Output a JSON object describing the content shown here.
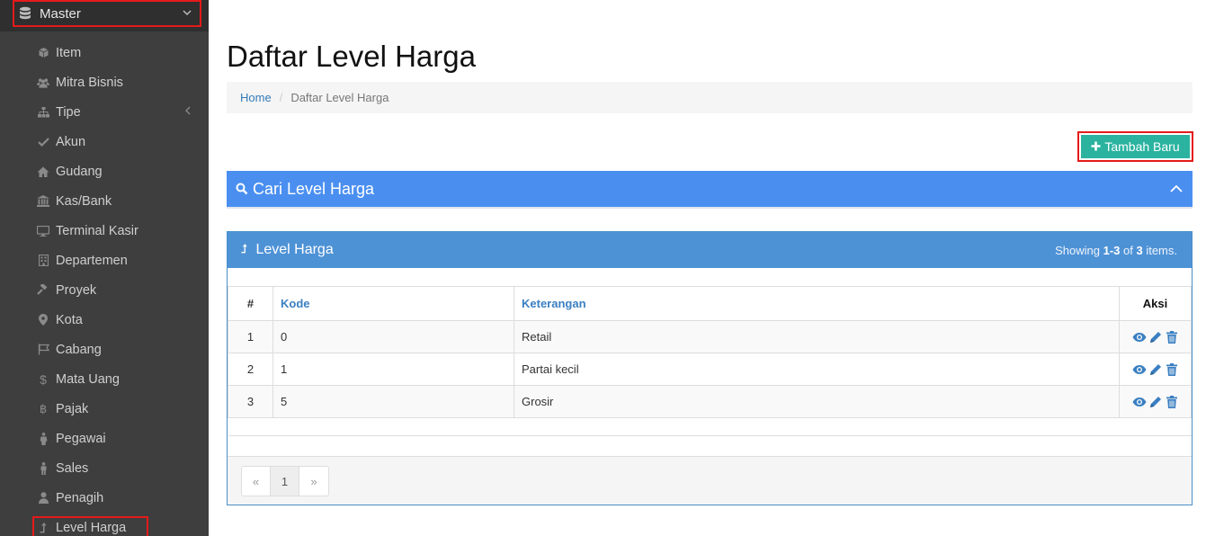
{
  "sidebar": {
    "master_label": "Master",
    "items": [
      {
        "label": "Item",
        "icon": "cube-icon"
      },
      {
        "label": "Mitra Bisnis",
        "icon": "users-icon"
      },
      {
        "label": "Tipe",
        "icon": "sitemap-icon"
      },
      {
        "label": "Akun",
        "icon": "check-icon"
      },
      {
        "label": "Gudang",
        "icon": "home-icon"
      },
      {
        "label": "Kas/Bank",
        "icon": "bank-icon"
      },
      {
        "label": "Terminal Kasir",
        "icon": "desktop-icon"
      },
      {
        "label": "Departemen",
        "icon": "building-icon"
      },
      {
        "label": "Proyek",
        "icon": "gavel-icon"
      },
      {
        "label": "Kota",
        "icon": "map-marker-icon"
      },
      {
        "label": "Cabang",
        "icon": "flag-icon"
      },
      {
        "label": "Mata Uang",
        "icon": "dollar-icon"
      },
      {
        "label": "Pajak",
        "icon": "bitcoin-icon"
      },
      {
        "label": "Pegawai",
        "icon": "person-icon"
      },
      {
        "label": "Sales",
        "icon": "male-icon"
      },
      {
        "label": "Penagih",
        "icon": "user-icon"
      },
      {
        "label": "Level Harga",
        "icon": "level-up-icon"
      }
    ]
  },
  "page": {
    "title": "Daftar Level Harga",
    "breadcrumb": {
      "home": "Home",
      "separator": "/",
      "current": "Daftar Level Harga"
    },
    "add_button": "Tambah Baru",
    "search_panel_title": "Cari Level Harga",
    "list_panel_title": "Level Harga",
    "summary": {
      "prefix": "Showing ",
      "range": "1-3",
      "middle": " of ",
      "total": "3",
      "suffix": " items."
    }
  },
  "table": {
    "headers": {
      "num": "#",
      "kode": "Kode",
      "keterangan": "Keterangan",
      "aksi": "Aksi"
    },
    "rows": [
      {
        "num": "1",
        "kode": "0",
        "keterangan": "Retail"
      },
      {
        "num": "2",
        "kode": "1",
        "keterangan": "Partai kecil"
      },
      {
        "num": "3",
        "kode": "5",
        "keterangan": "Grosir"
      }
    ]
  },
  "pagination": {
    "prev": "«",
    "current": "1",
    "next": "»"
  },
  "colors": {
    "sidebar_bg": "#3e3e3e",
    "highlight_outline": "#e41a1a",
    "add_button": "#2bb3a0",
    "search_panel": "#4a8ff0",
    "list_panel_head": "#4e92d6",
    "link": "#337ab7"
  }
}
